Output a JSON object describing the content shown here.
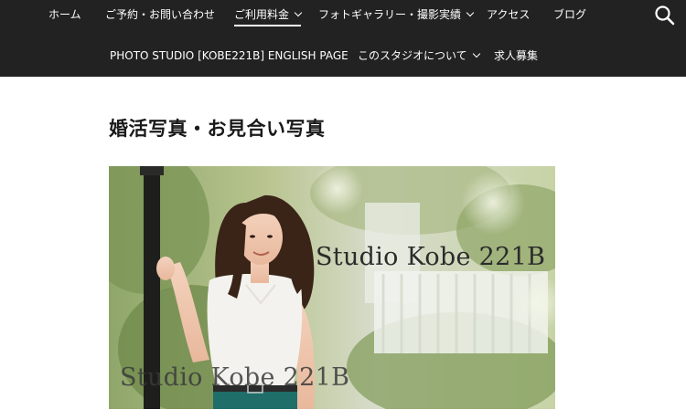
{
  "nav": {
    "row1": [
      {
        "label": "ホーム",
        "dropdown": false
      },
      {
        "label": "ご予約・お問い合わせ",
        "dropdown": false
      },
      {
        "label": "ご利用料金",
        "dropdown": true
      },
      {
        "label": "フォトギャラリー・撮影実績",
        "dropdown": true
      },
      {
        "label": "アクセス",
        "dropdown": false
      },
      {
        "label": "ブログ",
        "dropdown": false
      }
    ],
    "row2": [
      {
        "label": "PHOTO STUDIO [KOBE221B] ENGLISH PAGE",
        "dropdown": false
      },
      {
        "label": "このスタジオについて",
        "dropdown": true
      },
      {
        "label": "求人募集",
        "dropdown": false
      }
    ],
    "search_icon": "search-icon"
  },
  "page": {
    "title": "婚活写真・お見合い写真"
  },
  "hero": {
    "watermark_1": "Studio Kobe 221B",
    "watermark_2": "Studio Kobe 221B"
  },
  "colors": {
    "nav_bg": "#222222",
    "nav_text": "#ffffff"
  }
}
